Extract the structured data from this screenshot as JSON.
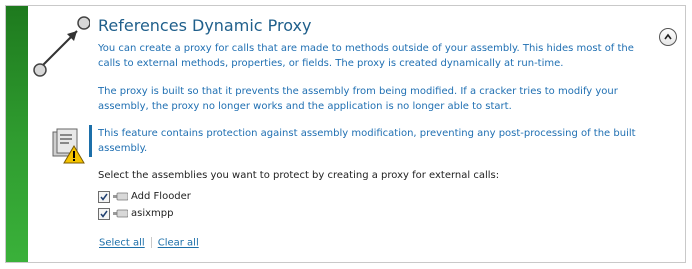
{
  "section": {
    "title": "References Dynamic Proxy",
    "description1": "You can create a proxy for calls that are made to methods outside of your assembly. This hides most of the calls to external methods, properties, or fields. The proxy is created dynamically at run-time.",
    "description2": "The proxy is built so that it prevents the assembly from being modified. If a cracker tries to modify your assembly, the proxy no longer works and the application is no longer able to start.",
    "note": "This feature contains protection against assembly modification, preventing any post-processing of the built assembly.",
    "collapse_icon": "chevron-up-icon"
  },
  "assemblies": {
    "prompt": "Select the assemblies you want to protect by creating a proxy for external calls:",
    "items": [
      {
        "name": "Add Flooder",
        "checked": true
      },
      {
        "name": "asixmpp",
        "checked": true
      }
    ]
  },
  "actions": {
    "select_all": "Select all",
    "clear_all": "Clear all"
  },
  "colors": {
    "accent_green": "#2f9b2f",
    "title_blue": "#1f5f8b",
    "text_blue": "#1f6fb2"
  }
}
